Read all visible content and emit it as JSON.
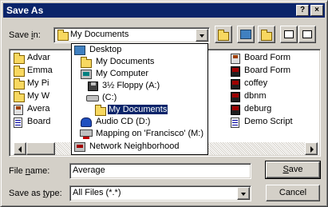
{
  "dialog": {
    "title": "Save As",
    "title_buttons": {
      "help": "?",
      "close": "×"
    }
  },
  "save_in": {
    "label_pre": "Save ",
    "label_accel": "i",
    "label_post": "n:",
    "value": "My Documents"
  },
  "toolbar": {
    "buttons": [
      "up-one-level-icon",
      "desktop-icon",
      "new-folder-icon",
      "list-view-icon",
      "details-view-icon"
    ]
  },
  "file_list": {
    "left_column": [
      {
        "label": "Advar",
        "icon": "folder-icon"
      },
      {
        "label": "Emma",
        "icon": "folder-icon"
      },
      {
        "label": "My Pi",
        "icon": "folder-icon"
      },
      {
        "label": "My W",
        "icon": "folder-icon"
      },
      {
        "label": "Avera",
        "icon": "form-icon"
      },
      {
        "label": "Board",
        "icon": "doc-icon"
      }
    ],
    "right_column": [
      {
        "label": "Board Form",
        "icon": "form-icon"
      },
      {
        "label": "Board Form",
        "icon": "database-icon"
      },
      {
        "label": "coffey",
        "icon": "database-icon"
      },
      {
        "label": "dbnm",
        "icon": "database-icon"
      },
      {
        "label": "deburg",
        "icon": "database-icon"
      },
      {
        "label": "Demo Script",
        "icon": "doc-icon"
      }
    ]
  },
  "dropdown": {
    "items": [
      {
        "label": "Desktop",
        "icon": "desktop-icon"
      },
      {
        "label": "My Documents",
        "icon": "folder-icon"
      },
      {
        "label": "My Computer",
        "icon": "computer-icon"
      },
      {
        "label": "3½ Floppy (A:)",
        "icon": "floppy-icon"
      },
      {
        "label": "(C:)",
        "icon": "drive-icon"
      },
      {
        "label": "My Documents",
        "icon": "folder-icon",
        "selected": true
      },
      {
        "label": "Audio CD (D:)",
        "icon": "cd-icon"
      },
      {
        "label": "Mapping on 'Francisco' (M:)",
        "icon": "network-drive-icon"
      },
      {
        "label": "Network Neighborhood",
        "icon": "network-icon"
      }
    ]
  },
  "file_name": {
    "label_pre": "File ",
    "label_accel": "n",
    "label_post": "ame:",
    "value": "Average"
  },
  "save_as_type": {
    "label_pre": "Save as ",
    "label_accel": "t",
    "label_post": "ype:",
    "value": "All Files (*.*)"
  },
  "buttons": {
    "save_accel": "S",
    "save_rest": "ave",
    "cancel": "Cancel"
  },
  "colors": {
    "title_bar": "#0a246a",
    "face": "#d4d0c8",
    "selection": "#0a246a"
  }
}
